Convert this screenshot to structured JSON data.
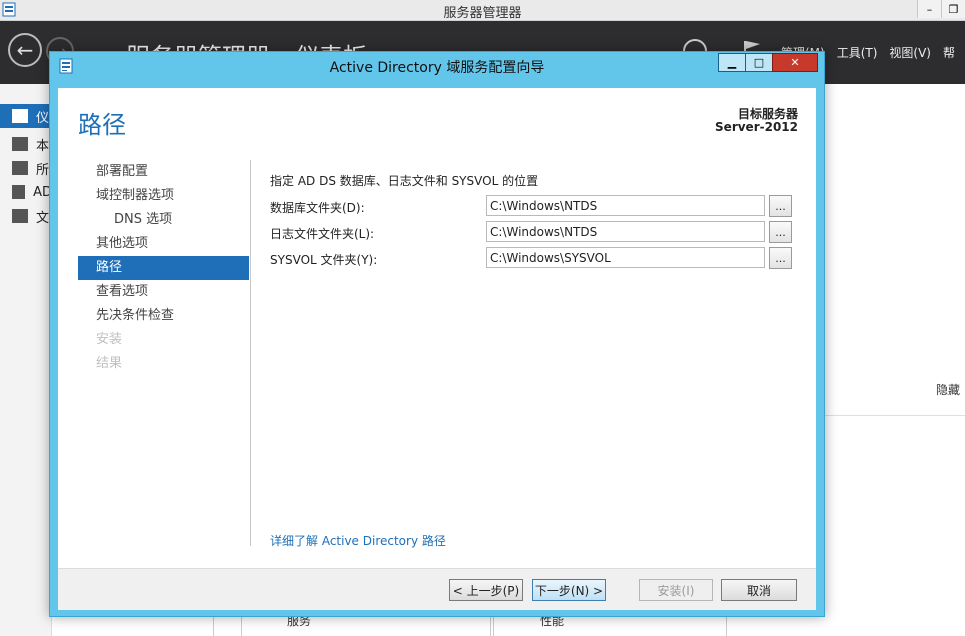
{
  "server_manager": {
    "window_title": "服务器管理器",
    "nav_title": "服务器管理器 › 仪表板",
    "menu": [
      "管理(M)",
      "工具(T)",
      "视图(V)",
      "帮"
    ],
    "sidebar": [
      "仪",
      "本",
      "所",
      "AD",
      "文"
    ],
    "hide_label": "隐藏",
    "tile_labels": [
      "服务",
      "性能"
    ],
    "window_buttons": [
      "–",
      "❐"
    ]
  },
  "dialog": {
    "title": "Active Directory 域服务配置向导",
    "buttons": {
      "minimize": "▁",
      "maximize": "□",
      "close": "✕"
    },
    "heading": "路径",
    "target_label": "目标服务器",
    "target_name": "Server-2012",
    "nav": [
      {
        "label": "部署配置",
        "state": "normal",
        "level": 0
      },
      {
        "label": "域控制器选项",
        "state": "normal",
        "level": 0
      },
      {
        "label": "DNS 选项",
        "state": "normal",
        "level": 1
      },
      {
        "label": "其他选项",
        "state": "normal",
        "level": 0
      },
      {
        "label": "路径",
        "state": "active",
        "level": 0
      },
      {
        "label": "查看选项",
        "state": "normal",
        "level": 0
      },
      {
        "label": "先决条件检查",
        "state": "normal",
        "level": 0
      },
      {
        "label": "安装",
        "state": "disabled",
        "level": 0
      },
      {
        "label": "结果",
        "state": "disabled",
        "level": 0
      }
    ],
    "description": "指定 AD DS 数据库、日志文件和 SYSVOL 的位置",
    "fields": [
      {
        "label": "数据库文件夹(D):",
        "value": "C:\\Windows\\NTDS",
        "browse": "..."
      },
      {
        "label": "日志文件文件夹(L):",
        "value": "C:\\Windows\\NTDS",
        "browse": "..."
      },
      {
        "label": "SYSVOL 文件夹(Y):",
        "value": "C:\\Windows\\SYSVOL",
        "browse": "..."
      }
    ],
    "learn_more": "详细了解 Active Directory 路径",
    "footer": {
      "prev": "< 上一步(P)",
      "next": "下一步(N) >",
      "install": "安装(I)",
      "cancel": "取消"
    }
  },
  "colors": {
    "accent": "#1e6fb8",
    "dialog_frame": "#62c6eb",
    "close_button": "#c7392a",
    "navbar": "#2d2d30"
  }
}
